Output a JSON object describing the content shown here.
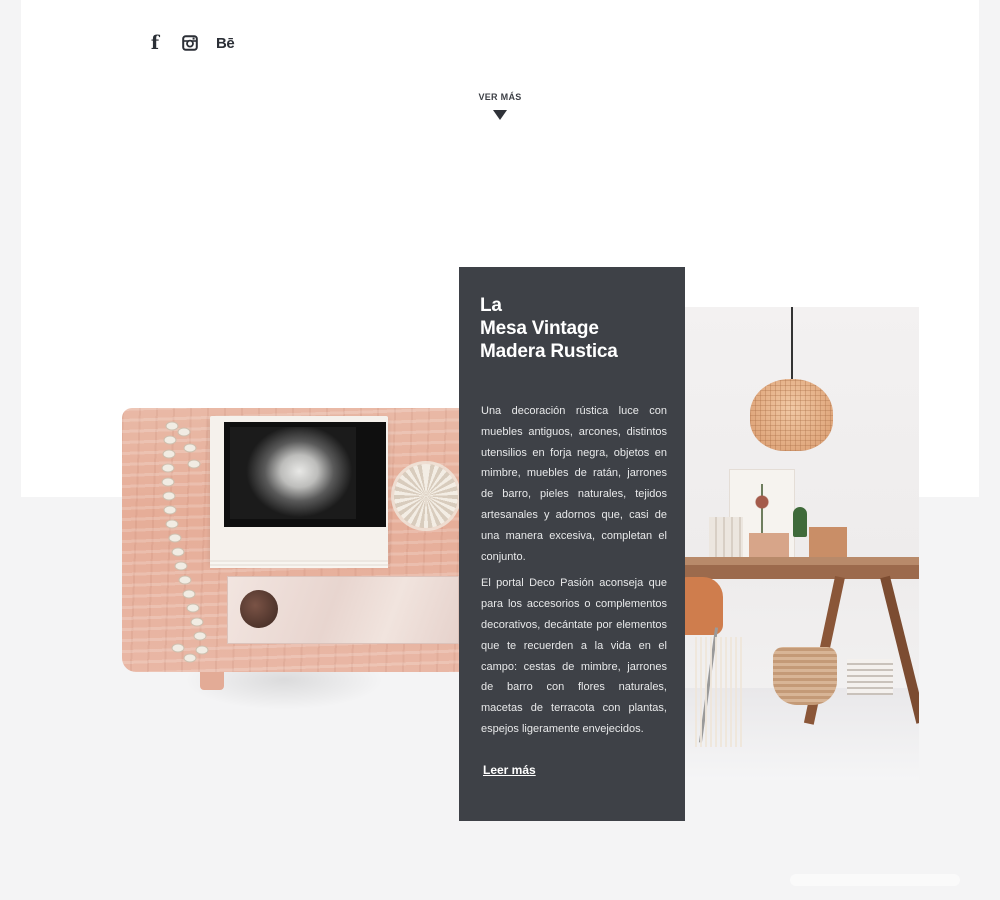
{
  "social": {
    "facebook_glyph": "f",
    "behance_glyph": "Bē",
    "icons": [
      "facebook-icon",
      "instagram-icon",
      "behance-icon"
    ]
  },
  "ver_mas": {
    "label": "VER MÁS"
  },
  "card": {
    "title_lines": [
      "La",
      "Mesa Vintage",
      "Madera Rustica"
    ],
    "paragraphs": [
      "Una decoración rústica luce con muebles antiguos, arcones, distintos utensilios en forja negra, objetos en mimbre, muebles de ratán, jarrones de barro, pieles naturales, tejidos artesanales y adornos que, casi de una manera excesiva, completan el conjunto.",
      "El portal Deco Pasión aconseja que para los accesorios o complementos decorativos, decántate por elementos que te recuerden a la vida en el campo: cestas de mimbre, jarrones de barro con flores naturales, macetas de terracota con plantas, espejos ligeramente envejecidos."
    ],
    "read_more": "Leer más"
  },
  "colors": {
    "page_bg": "#f4f4f5",
    "panel_bg": "#ffffff",
    "card_bg": "#3e4147",
    "card_text": "#ffffff",
    "icon_color": "#2b2f36"
  }
}
